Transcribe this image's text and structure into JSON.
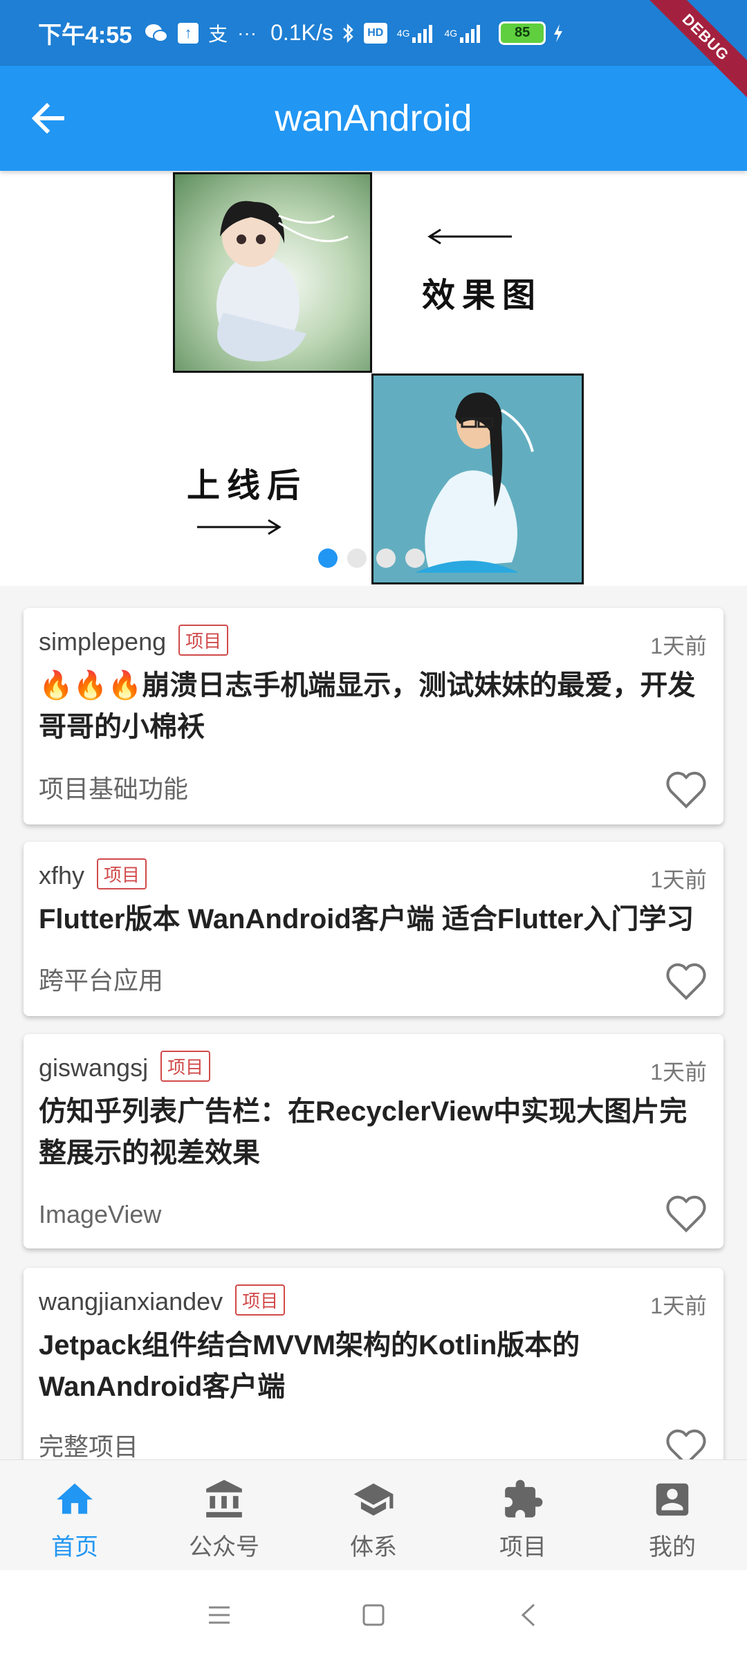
{
  "status_bar": {
    "time": "下午4:55",
    "net_speed": "0.1K/s",
    "battery": "85",
    "network_1": "4G",
    "network_2": "4G",
    "hd": "HD",
    "more": "···",
    "pay_icon": "支"
  },
  "debug_label": "DEBUG",
  "app_bar": {
    "title": "wanAndroid"
  },
  "banner": {
    "caption_effect": "效果图",
    "caption_online": "上线后",
    "dots_total": 4,
    "active_dot": 0
  },
  "articles": [
    {
      "author": "simplepeng",
      "tag": "项目",
      "time": "1天前",
      "title": "🔥🔥🔥崩溃日志手机端显示，测试妹妹的最爱，开发哥哥的小棉袄",
      "category": "项目基础功能"
    },
    {
      "author": "xfhy",
      "tag": "项目",
      "time": "1天前",
      "title": "Flutter版本 WanAndroid客户端 适合Flutter入门学习",
      "category": "跨平台应用"
    },
    {
      "author": "giswangsj",
      "tag": "项目",
      "time": "1天前",
      "title": "仿知乎列表广告栏：在RecyclerView中实现大图片完整展示的视差效果",
      "category": "ImageView"
    },
    {
      "author": "wangjianxiandev",
      "tag": "项目",
      "time": "1天前",
      "title": "Jetpack组件结合MVVM架构的Kotlin版本的WanAndroid客户端",
      "category": "完整项目"
    }
  ],
  "bottom_nav": {
    "items": [
      {
        "label": "首页",
        "icon": "home-icon",
        "active": true
      },
      {
        "label": "公众号",
        "icon": "bank-icon",
        "active": false
      },
      {
        "label": "体系",
        "icon": "school-icon",
        "active": false
      },
      {
        "label": "项目",
        "icon": "puzzle-icon",
        "active": false
      },
      {
        "label": "我的",
        "icon": "account-box-icon",
        "active": false
      }
    ]
  },
  "colors": {
    "primary": "#2196f3",
    "status_bar": "#1e7fd4",
    "tag_red": "#d14a4a"
  }
}
